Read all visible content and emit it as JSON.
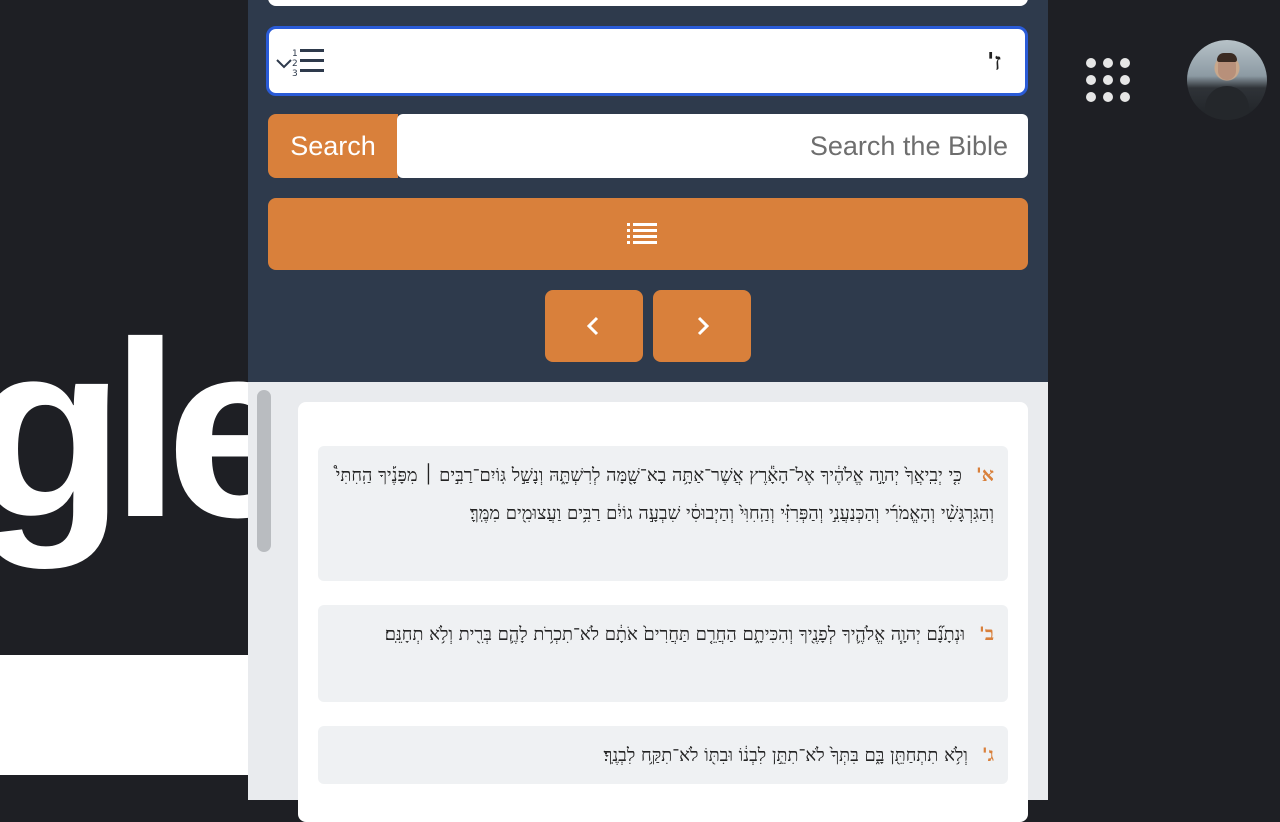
{
  "header": {
    "book_chapter_select": {
      "selected": "ז'"
    },
    "search": {
      "button_label": "Search",
      "placeholder": "Search the Bible"
    }
  },
  "background": {
    "logo_fragment": "gle"
  },
  "colors": {
    "accent": "#d9803b",
    "header_bg": "#2e3a4c",
    "focus_border": "#2a5bd7"
  },
  "icons": {
    "select_icon": "numbered-list-chevron-icon",
    "menu_icon": "list-icon",
    "prev_icon": "chevron-left-icon",
    "next_icon": "chevron-right-icon",
    "apps_icon": "apps-grid-icon"
  },
  "verses": [
    {
      "num": "א'",
      "text": "כִּ֤י יְבִֽיאֲךָ֙ יְהוָ֣ה אֱלֹהֶ֔יךָ אֶל־הָאָ֕רֶץ אֲשֶׁר־אַתָּ֥ה בָא־שָׁ֖מָּה לְרִשְׁתָּ֑הּ וְנָשַׁ֣ל גּֽוֹיִם־רַבִּ֣ים ׀ מִפָּנֶ֡יךָ הַֽחִתִּי֩ וְהַגִּרְגָּשִׁ֨י וְהָאֱמֹרִ֜י וְהַכְּנַעֲנִ֣י וְהַפְּרִזִּ֗י וְהַֽחִוִּי֙ וְהַיְבוּסִ֔י שִׁבְעָ֣ה גוֹיִ֔ם רַבִּ֥ים וַעֲצוּמִ֖ים מִמֶּֽךָּ׃"
    },
    {
      "num": "ב'",
      "text": "וּנְתָנָ֞ם יְהוָ֧ה אֱלֹהֶ֛יךָ לְפָנֶ֖יךָ וְהִכִּיתָ֑ם הַחֲרֵ֤ם תַּחֲרִים֙ אֹתָ֔ם לֹא־תִכְרֹ֥ת לָהֶ֛ם בְּרִ֖ית וְלֹ֥א תְחָנֵּֽם׃"
    },
    {
      "num": "ג'",
      "text": "וְלֹ֥א תִתְחַתֵּ֖ן בָּ֑ם בִּתְּךָ֙ לֹא־תִתֵּ֣ן לִבְנ֔וֹ וּבִתּ֖וֹ לֹא־תִקַּ֥ח לִבְנֶֽךָ׃"
    }
  ]
}
